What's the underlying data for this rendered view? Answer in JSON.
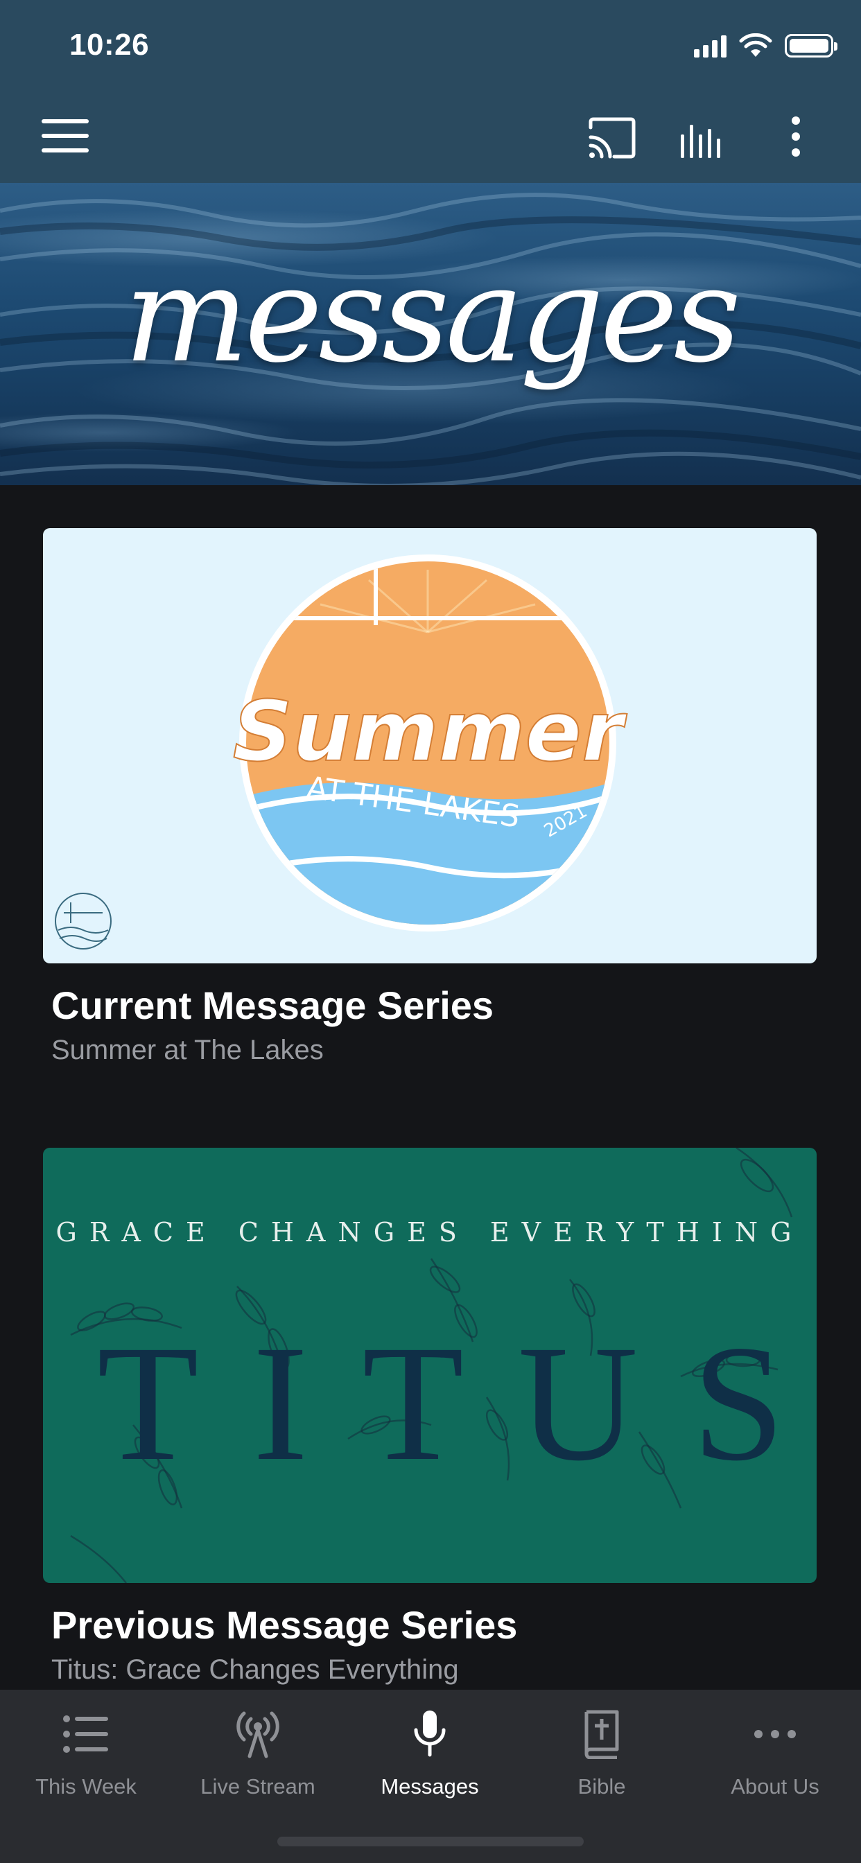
{
  "status_bar": {
    "time": "10:26"
  },
  "app_bar": {
    "icons": [
      "menu-icon",
      "cast-icon",
      "audio-bars-icon",
      "more-vertical-icon"
    ]
  },
  "hero": {
    "title": "messages"
  },
  "cards": [
    {
      "title": "Current Message Series",
      "subtitle": "Summer at The Lakes",
      "artwork": {
        "word": "Summer",
        "caption": "AT THE LAKES",
        "year": "2021"
      }
    },
    {
      "title": "Previous Message Series",
      "subtitle": "Titus: Grace Changes Everything",
      "artwork": {
        "kicker": "GRACE CHANGES EVERYTHING",
        "word": "TITUS"
      }
    }
  ],
  "tab_bar": {
    "items": [
      {
        "label": "This Week",
        "icon": "list-icon",
        "active": false
      },
      {
        "label": "Live Stream",
        "icon": "broadcast-icon",
        "active": false
      },
      {
        "label": "Messages",
        "icon": "microphone-icon",
        "active": true
      },
      {
        "label": "Bible",
        "icon": "bible-icon",
        "active": false
      },
      {
        "label": "About Us",
        "icon": "ellipsis-icon",
        "active": false
      }
    ]
  },
  "colors": {
    "app_bar": "#2a4a5f",
    "background": "#141518",
    "tab_bar": "#2a2c30",
    "summer_orange": "#f5ab63",
    "summer_blue": "#7cc6f2",
    "titus_green": "#0f6b5b"
  }
}
